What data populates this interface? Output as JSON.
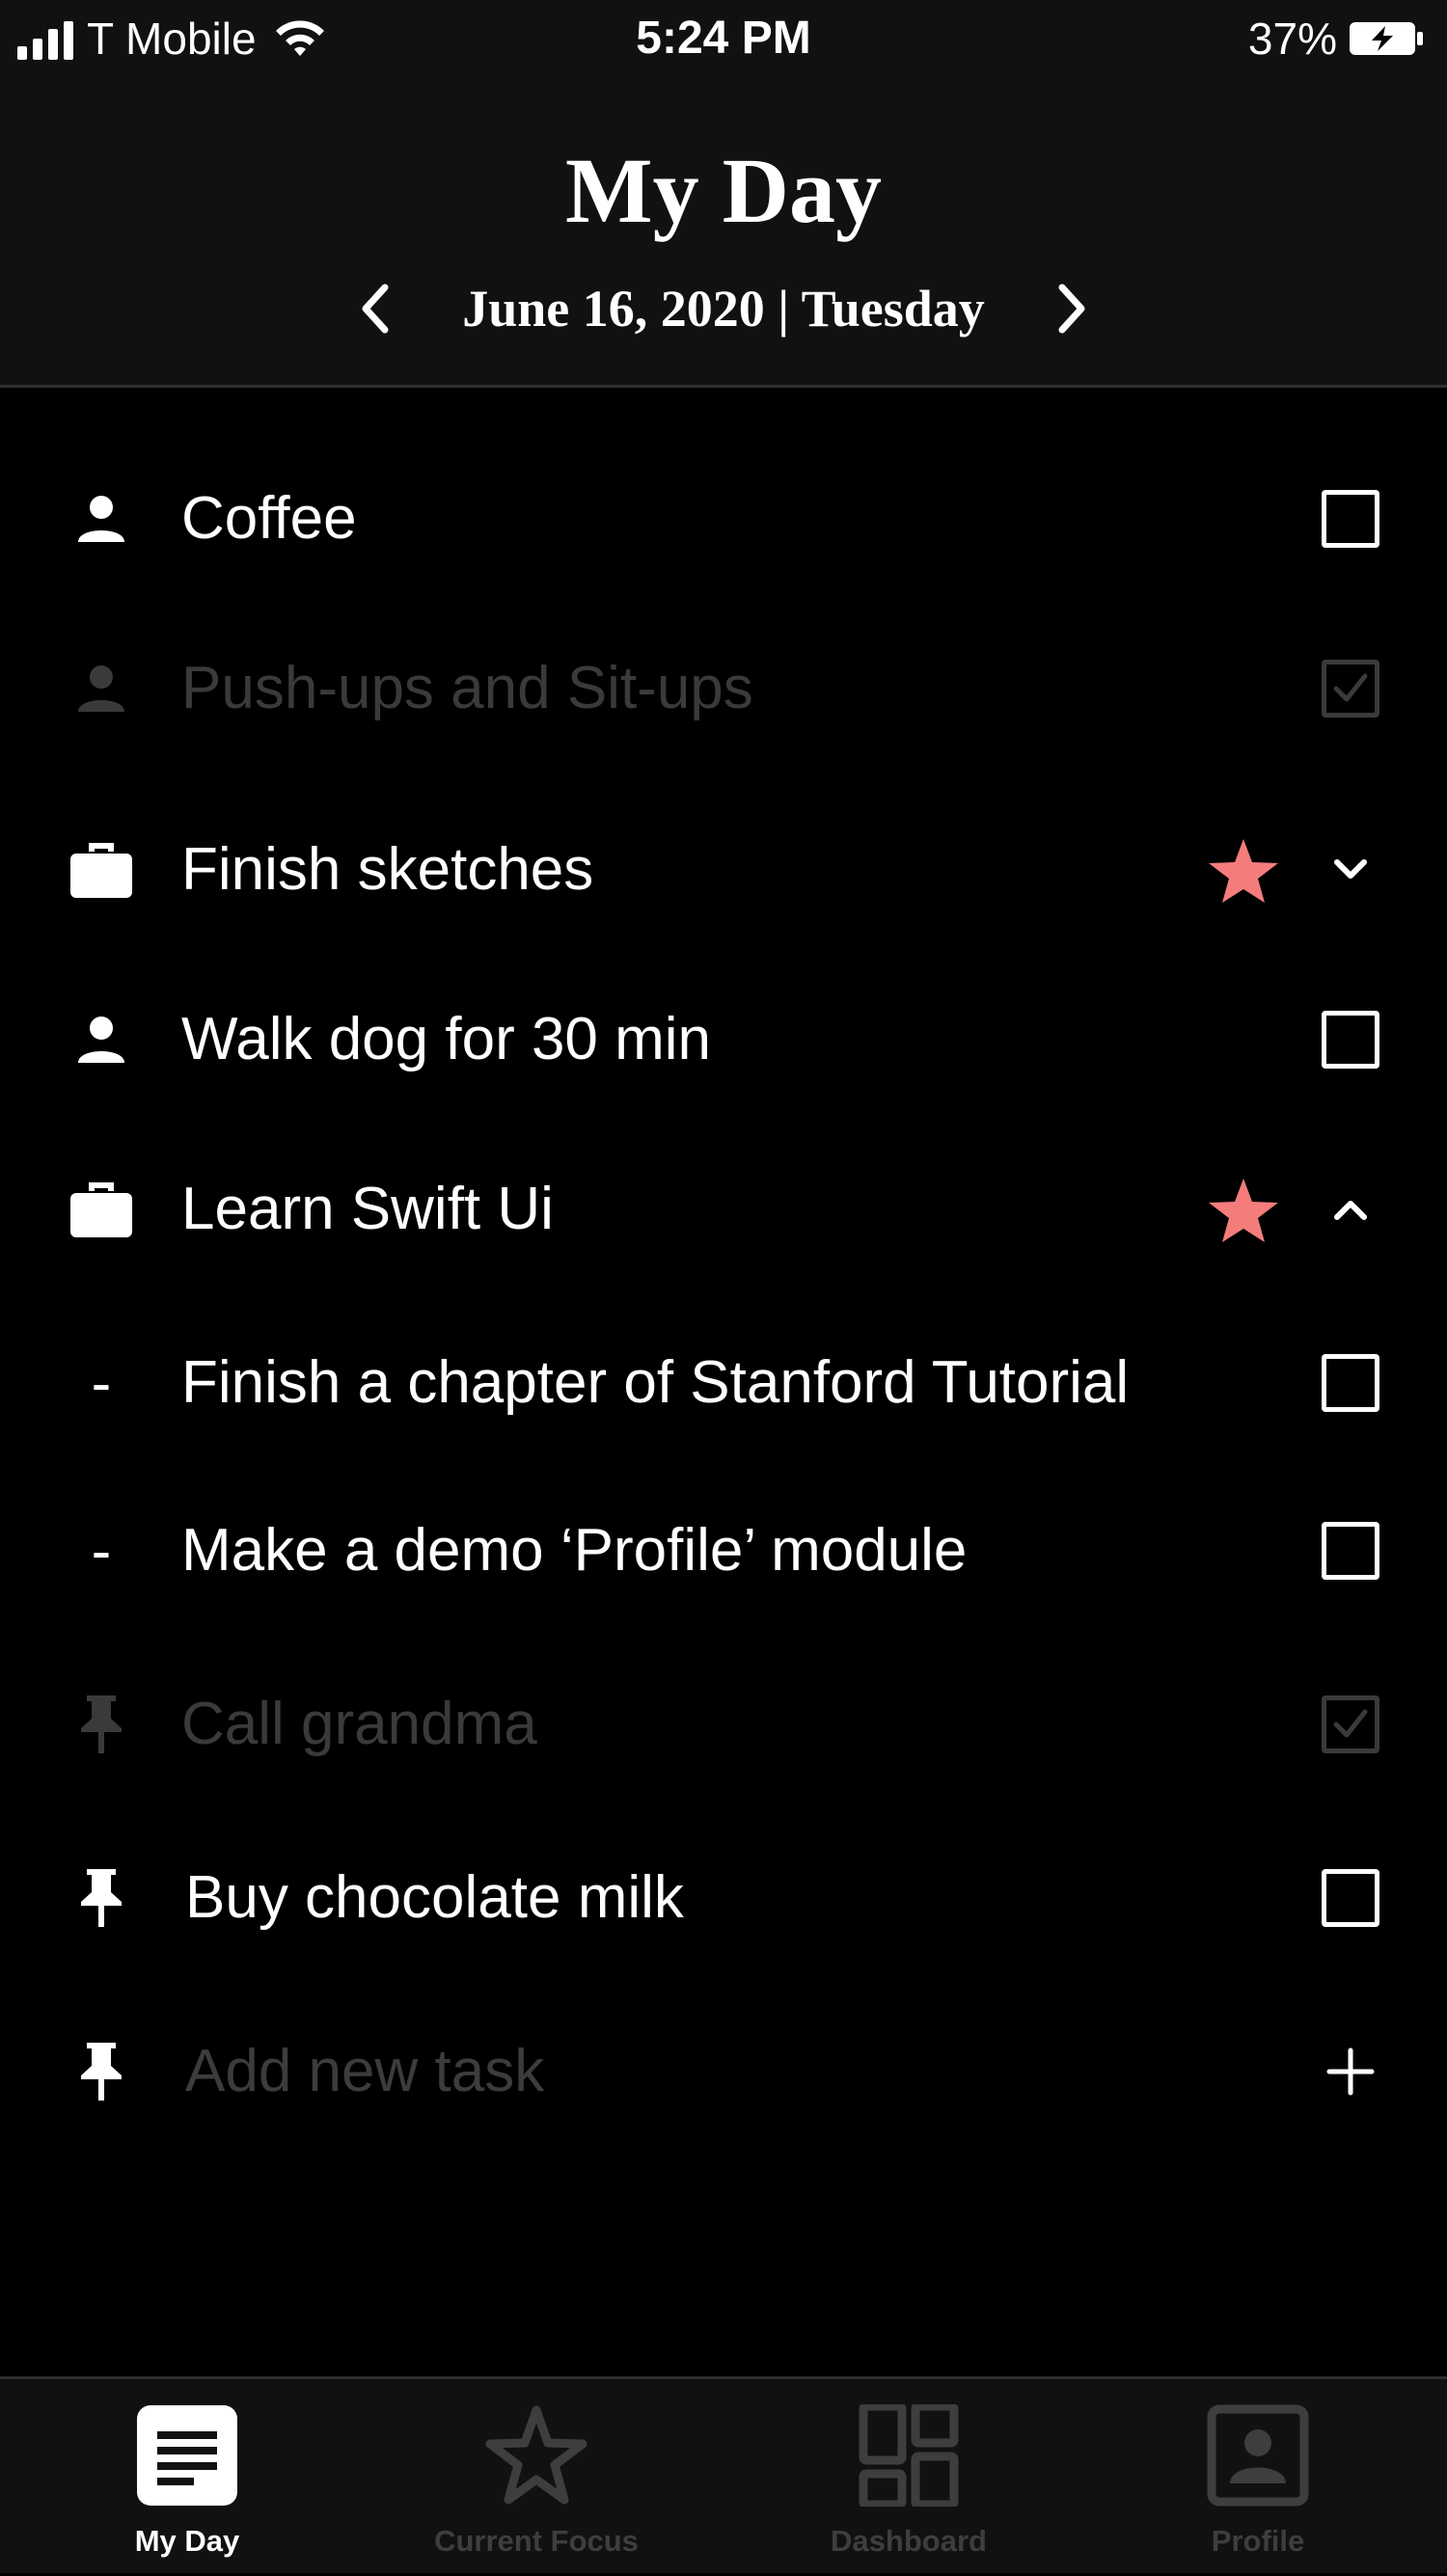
{
  "status_bar": {
    "carrier": "T Mobile",
    "time": "5:24 PM",
    "battery_percent": "37%"
  },
  "header": {
    "title": "My Day",
    "date": "June 16, 2020 | Tuesday"
  },
  "tasks": [
    {
      "label": "Coffee",
      "icon": "person-icon",
      "done": false
    },
    {
      "label": "Push-ups and Sit-ups",
      "icon": "person-icon",
      "done": true
    },
    {
      "label": "Finish sketches",
      "icon": "briefcase-icon",
      "starred": true,
      "expandable": "collapsed"
    },
    {
      "label": "Walk dog for 30 min",
      "icon": "person-icon",
      "done": false
    },
    {
      "label": "Learn Swift Ui",
      "icon": "briefcase-icon",
      "starred": true,
      "expandable": "expanded"
    },
    {
      "label": "Finish a chapter of Stanford Tutorial",
      "icon": "dash",
      "done": false
    },
    {
      "label": "Make a demo ‘Profile’ module",
      "icon": "dash",
      "done": false
    },
    {
      "label": "Call grandma",
      "icon": "pin-icon",
      "done": true
    },
    {
      "label": "Buy chocolate milk",
      "icon": "pin-icon",
      "done": false
    }
  ],
  "add_task": {
    "placeholder": "Add new task",
    "icon": "pin-icon"
  },
  "tab_bar": {
    "tabs": [
      {
        "label": "My Day",
        "icon": "document-icon",
        "active": true
      },
      {
        "label": "Current Focus",
        "icon": "star-outline-icon",
        "active": false
      },
      {
        "label": "Dashboard",
        "icon": "dashboard-icon",
        "active": false
      },
      {
        "label": "Profile",
        "icon": "profile-icon",
        "active": false
      }
    ]
  },
  "colors": {
    "background": "#000000",
    "bars": "#111111",
    "star": "#f47d7c",
    "done_text": "#3a3a3a",
    "inactive_tab": "#3e3e3e"
  }
}
